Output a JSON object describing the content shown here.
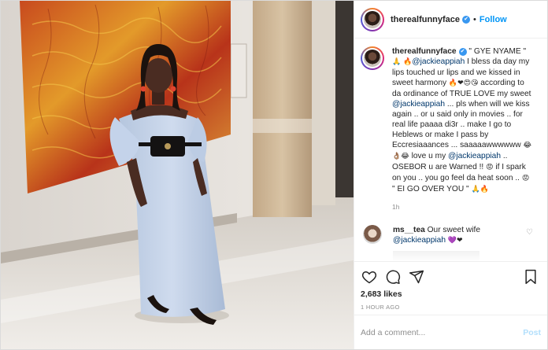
{
  "post": {
    "username": "therealfunnyface",
    "separator": "•",
    "follow_label": "Follow",
    "verified_icon": "verified-check-icon"
  },
  "caption": {
    "username": "therealfunnyface",
    "line1": "\" GYE NYAME \" ",
    "mention1": "@jackieappiah",
    "part2": " I bless da day my lips touched ur lips and we kissed in sweet harmony ",
    "part3": " according to da ordinance of TRUE LOVE my sweet ",
    "mention2": "@jackieappiah",
    "part4": " ... pls when will we kiss again .. or u said only in movies .. for real life paaaa di3r .. make I go to Heblews or make I pass by Eccresiaaances ... saaaaawwwwww ",
    "part5": " love u my ",
    "mention3": "@jackieappiah",
    "part6": " .. OSEBOR u are Warned !! ",
    "part7": " if I spark on you .. you go feel da heat soon .. ",
    "part8": " \" EI GO OVER YOU \" ",
    "emoji_a": "🙏",
    "emoji_b": "🔥",
    "emoji_c": "🔥❤😍😘",
    "emoji_d": "😂👌🏽😂",
    "emoji_e": "😡",
    "emoji_f": "😡",
    "emoji_g": "🙏🔥",
    "time": "1h"
  },
  "comment": {
    "username": "ms__tea",
    "text": " Our sweet wife ",
    "mention": "@jackieappiah",
    "emoji": "💜❤"
  },
  "actions": {
    "likes": "2,683 likes",
    "timestamp": "1 HOUR AGO"
  },
  "add_comment": {
    "placeholder": "Add a comment...",
    "post_label": "Post"
  },
  "colors": {
    "accent": "#0095f6",
    "verified": "#3897f0",
    "text": "#262626",
    "muted": "#8e8e8e",
    "mention": "#00376b"
  }
}
